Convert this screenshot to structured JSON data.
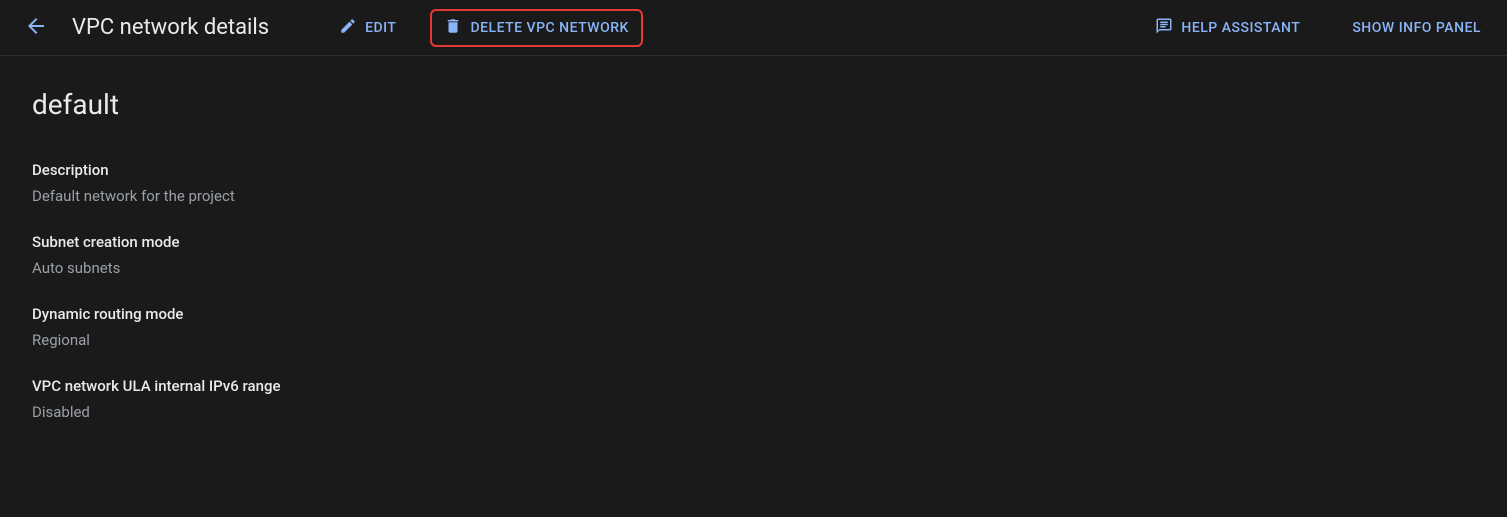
{
  "header": {
    "title": "VPC network details",
    "edit_label": "EDIT",
    "delete_label": "DELETE VPC NETWORK",
    "help_label": "HELP ASSISTANT",
    "info_panel_label": "SHOW INFO PANEL"
  },
  "network": {
    "name": "default"
  },
  "fields": {
    "description": {
      "label": "Description",
      "value": "Default network for the project"
    },
    "subnet_mode": {
      "label": "Subnet creation mode",
      "value": "Auto subnets"
    },
    "routing_mode": {
      "label": "Dynamic routing mode",
      "value": "Regional"
    },
    "ula_range": {
      "label": "VPC network ULA internal IPv6 range",
      "value": "Disabled"
    }
  }
}
